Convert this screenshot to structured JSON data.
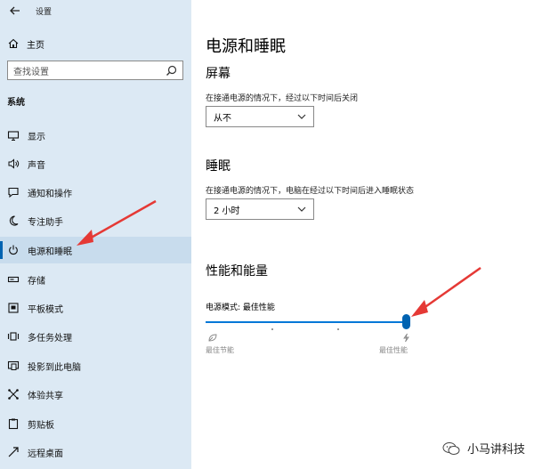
{
  "window": {
    "title": "设置"
  },
  "sidebar": {
    "home_label": "主页",
    "search_placeholder": "查找设置",
    "section_label": "系统",
    "items": [
      {
        "label": "显示",
        "icon": "monitor-icon"
      },
      {
        "label": "声音",
        "icon": "speaker-icon"
      },
      {
        "label": "通知和操作",
        "icon": "notification-icon"
      },
      {
        "label": "专注助手",
        "icon": "moon-icon"
      },
      {
        "label": "电源和睡眠",
        "icon": "power-icon",
        "selected": true
      },
      {
        "label": "存储",
        "icon": "storage-icon"
      },
      {
        "label": "平板模式",
        "icon": "tablet-icon"
      },
      {
        "label": "多任务处理",
        "icon": "multitask-icon"
      },
      {
        "label": "投影到此电脑",
        "icon": "project-icon"
      },
      {
        "label": "体验共享",
        "icon": "share-icon"
      },
      {
        "label": "剪贴板",
        "icon": "clipboard-icon"
      },
      {
        "label": "远程桌面",
        "icon": "remote-desktop-icon"
      }
    ]
  },
  "main": {
    "title": "电源和睡眠",
    "screen": {
      "heading": "屏幕",
      "description": "在接通电源的情况下，经过以下时间后关闭",
      "value": "从不"
    },
    "sleep": {
      "heading": "睡眠",
      "description": "在接通电源的情况下，电脑在经过以下时间后进入睡眠状态",
      "value": "2 小时"
    },
    "performance": {
      "heading": "性能和能量",
      "mode_label": "电源模式: 最佳性能",
      "slider_value": 1.0,
      "left_label": "最佳节能",
      "right_label": "最佳性能"
    }
  },
  "watermark": {
    "text": "小马讲科技"
  },
  "colors": {
    "sidebar_bg": "#dce9f4",
    "accent": "#0078d7",
    "annotation_arrow": "#e53935"
  }
}
